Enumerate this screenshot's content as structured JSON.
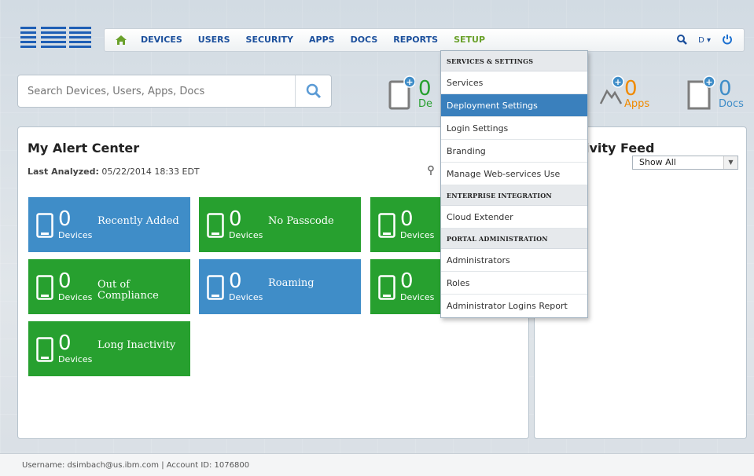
{
  "brand": {
    "logo_text": "IBM"
  },
  "nav": {
    "items": [
      {
        "label": "DEVICES"
      },
      {
        "label": "USERS"
      },
      {
        "label": "SECURITY"
      },
      {
        "label": "APPS"
      },
      {
        "label": "DOCS"
      },
      {
        "label": "REPORTS"
      },
      {
        "label": "SETUP"
      }
    ],
    "user_initial": "D ▾"
  },
  "search": {
    "placeholder": "Search Devices, Users, Apps, Docs"
  },
  "counters": {
    "devices": {
      "value": "0",
      "label": "De"
    },
    "apps": {
      "value": "0",
      "label": "Apps"
    },
    "docs": {
      "value": "0",
      "label": "Docs"
    }
  },
  "alert_center": {
    "title": "My Alert Center",
    "last_analyzed_label": "Last Analyzed:",
    "last_analyzed_value": " 05/22/2014 18:33 EDT",
    "tiles": [
      {
        "value": "0",
        "unit": "Devices",
        "label": "Recently Added"
      },
      {
        "value": "0",
        "unit": "Devices",
        "label": "No Passcode"
      },
      {
        "value": "0",
        "unit": "Devices",
        "label": ""
      },
      {
        "value": "0",
        "unit": "Devices",
        "label": "Out of Compliance"
      },
      {
        "value": "0",
        "unit": "Devices",
        "label": "Roaming"
      },
      {
        "value": "0",
        "unit": "Devices",
        "label": ""
      },
      {
        "value": "0",
        "unit": "Devices",
        "label": "Long Inactivity"
      }
    ]
  },
  "activity_feed": {
    "title": "ivity Feed",
    "filter": "Show All"
  },
  "setup_menu": {
    "sections": [
      {
        "header": "SERVICES & SETTINGS",
        "items": [
          "Services",
          "Deployment Settings",
          "Login Settings",
          "Branding",
          "Manage Web-services Use"
        ]
      },
      {
        "header": "ENTERPRISE INTEGRATION",
        "items": [
          "Cloud Extender"
        ]
      },
      {
        "header": "PORTAL ADMINISTRATION",
        "items": [
          "Administrators",
          "Roles",
          "Administrator Logins Report"
        ]
      }
    ],
    "selected": "Deployment Settings"
  },
  "footer": {
    "text": "Username:  dsimbach@us.ibm.com  | Account ID:  1076800"
  },
  "colors": {
    "green": "#27a02f",
    "blue": "#3f8dc8",
    "nav_blue": "#1b4f9c",
    "setup_green": "#6aa12b",
    "orange": "#f08a00"
  }
}
